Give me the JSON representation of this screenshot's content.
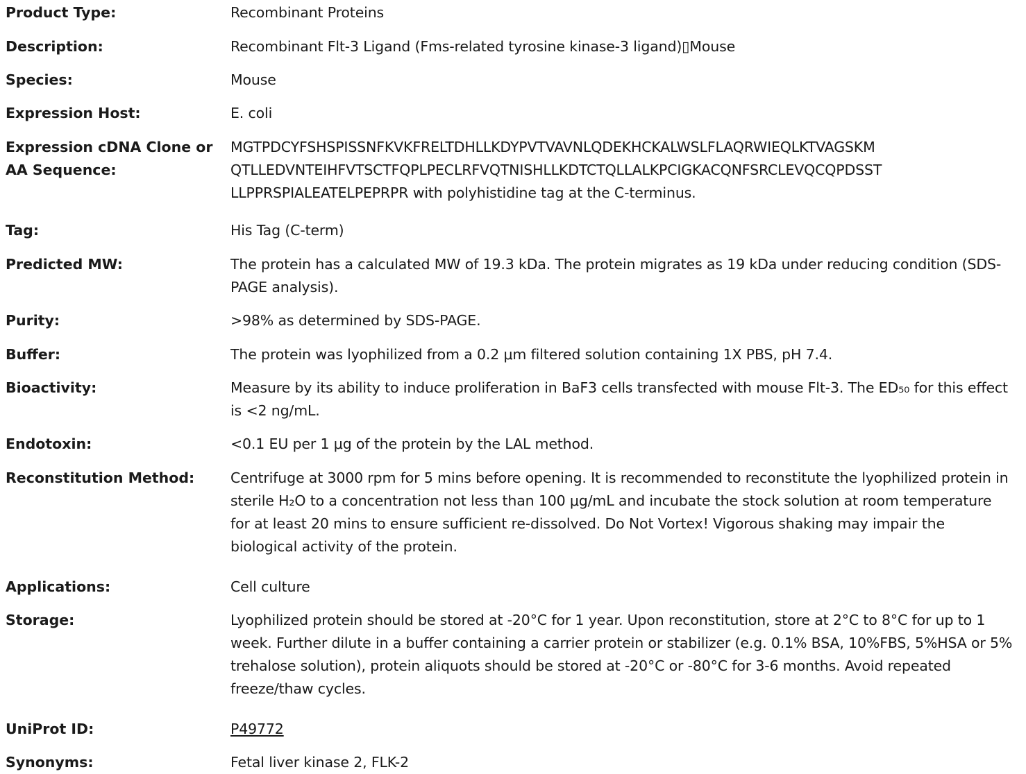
{
  "rows": [
    {
      "label": "Product Type:",
      "value": "Recombinant Proteins"
    },
    {
      "label": "Description:",
      "value": "Recombinant Flt-3 Ligand (Fms-related tyrosine kinase-3 ligand)▯Mouse"
    },
    {
      "label": "Species:",
      "value": "Mouse"
    },
    {
      "label": "Expression Host:",
      "value": "E. coli"
    },
    {
      "label": "Expression cDNA Clone or AA Sequence:",
      "value_lines": [
        "MGTPDCYFSHSPISSNFKVKFRELTDHLLKDYPVTVAVNLQDEKHCKALWSLFLAQRWIEQLKTVAGSKM",
        "QTLLEDVNTEIHFVTSCTFQPLPECLRFVQTNISHLLKDTCTQLLALKPCIGKACQNFSRCLEVQCQPDSST",
        "LLPPRSPIALEATELPEPRPR with polyhistidine tag at the C-terminus."
      ]
    },
    {
      "label": "Tag:",
      "value": "His Tag (C-term)"
    },
    {
      "label": "Predicted MW:",
      "value": "The protein has a calculated MW of 19.3 kDa. The protein migrates as 19 kDa under reducing condition (SDS-PAGE analysis)."
    },
    {
      "label": "Purity:",
      "value": ">98% as determined by SDS-PAGE."
    },
    {
      "label": "Buffer:",
      "value": "The protein was lyophilized from a 0.2 μm filtered solution containing 1X PBS, pH 7.4."
    },
    {
      "label": "Bioactivity:",
      "value": "Measure by its ability to induce proliferation in BaF3 cells transfected with mouse Flt-3. The ED₅₀ for this effect is <2 ng/mL."
    },
    {
      "label": "Endotoxin:",
      "value": "<0.1 EU per 1 μg of the protein by the LAL method."
    },
    {
      "label": "Reconstitution Method:",
      "value": "Centrifuge at 3000 rpm for 5 mins before opening. It is recommended to reconstitute the lyophilized protein in sterile H₂O to a concentration not less than 100 μg/mL and incubate the stock solution at room temperature for at least 20 mins to ensure sufficient re-dissolved. Do Not Vortex! Vigorous shaking may impair the biological activity of the protein."
    },
    {
      "label": "Applications:",
      "value": "Cell culture"
    },
    {
      "label": "Storage:",
      "value": "Lyophilized protein should be stored at -20°C for 1 year. Upon reconstitution, store at 2°C to 8°C for up to 1 week. Further dilute in a buffer containing a carrier protein or stabilizer (e.g. 0.1% BSA, 10%FBS, 5%HSA or 5% trehalose solution), protein aliquots should be stored at -20°C or -80°C for 3-6 months. Avoid repeated freeze/thaw cycles."
    },
    {
      "label": "UniProt ID:",
      "value": "P49772"
    },
    {
      "label": "Synonyms:",
      "value": "Fetal liver kinase 2, FLK-2"
    }
  ]
}
